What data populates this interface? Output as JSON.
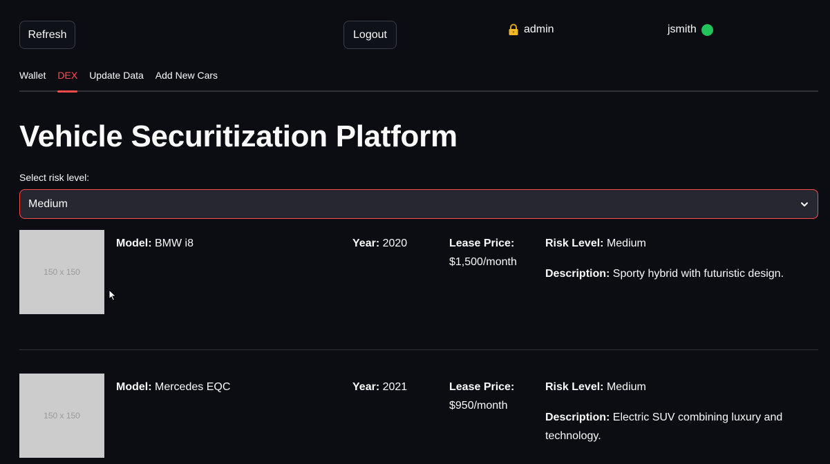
{
  "header": {
    "refresh_label": "Refresh",
    "logout_label": "Logout",
    "admin_label": "admin",
    "user_label": "jsmith",
    "status_color": "#21c35a"
  },
  "tabs": [
    {
      "label": "Wallet",
      "active": false
    },
    {
      "label": "DEX",
      "active": true
    },
    {
      "label": "Update Data",
      "active": false
    },
    {
      "label": "Add New Cars",
      "active": false
    }
  ],
  "page_title": "Vehicle Securitization Platform",
  "risk_select": {
    "label": "Select risk level:",
    "value": "Medium"
  },
  "field_labels": {
    "model": "Model:",
    "year": "Year:",
    "price": "Lease Price:",
    "risk": "Risk Level:",
    "description": "Description:"
  },
  "cars": [
    {
      "image_placeholder": "150 x 150",
      "model": "BMW i8",
      "year": "2020",
      "price": "$1,500/month",
      "risk": "Medium",
      "description": "Sporty hybrid with futuristic design."
    },
    {
      "image_placeholder": "150 x 150",
      "model": "Mercedes EQC",
      "year": "2021",
      "price": "$950/month",
      "risk": "Medium",
      "description": "Electric SUV combining luxury and technology."
    }
  ],
  "accent_color": "#ff4b4b"
}
